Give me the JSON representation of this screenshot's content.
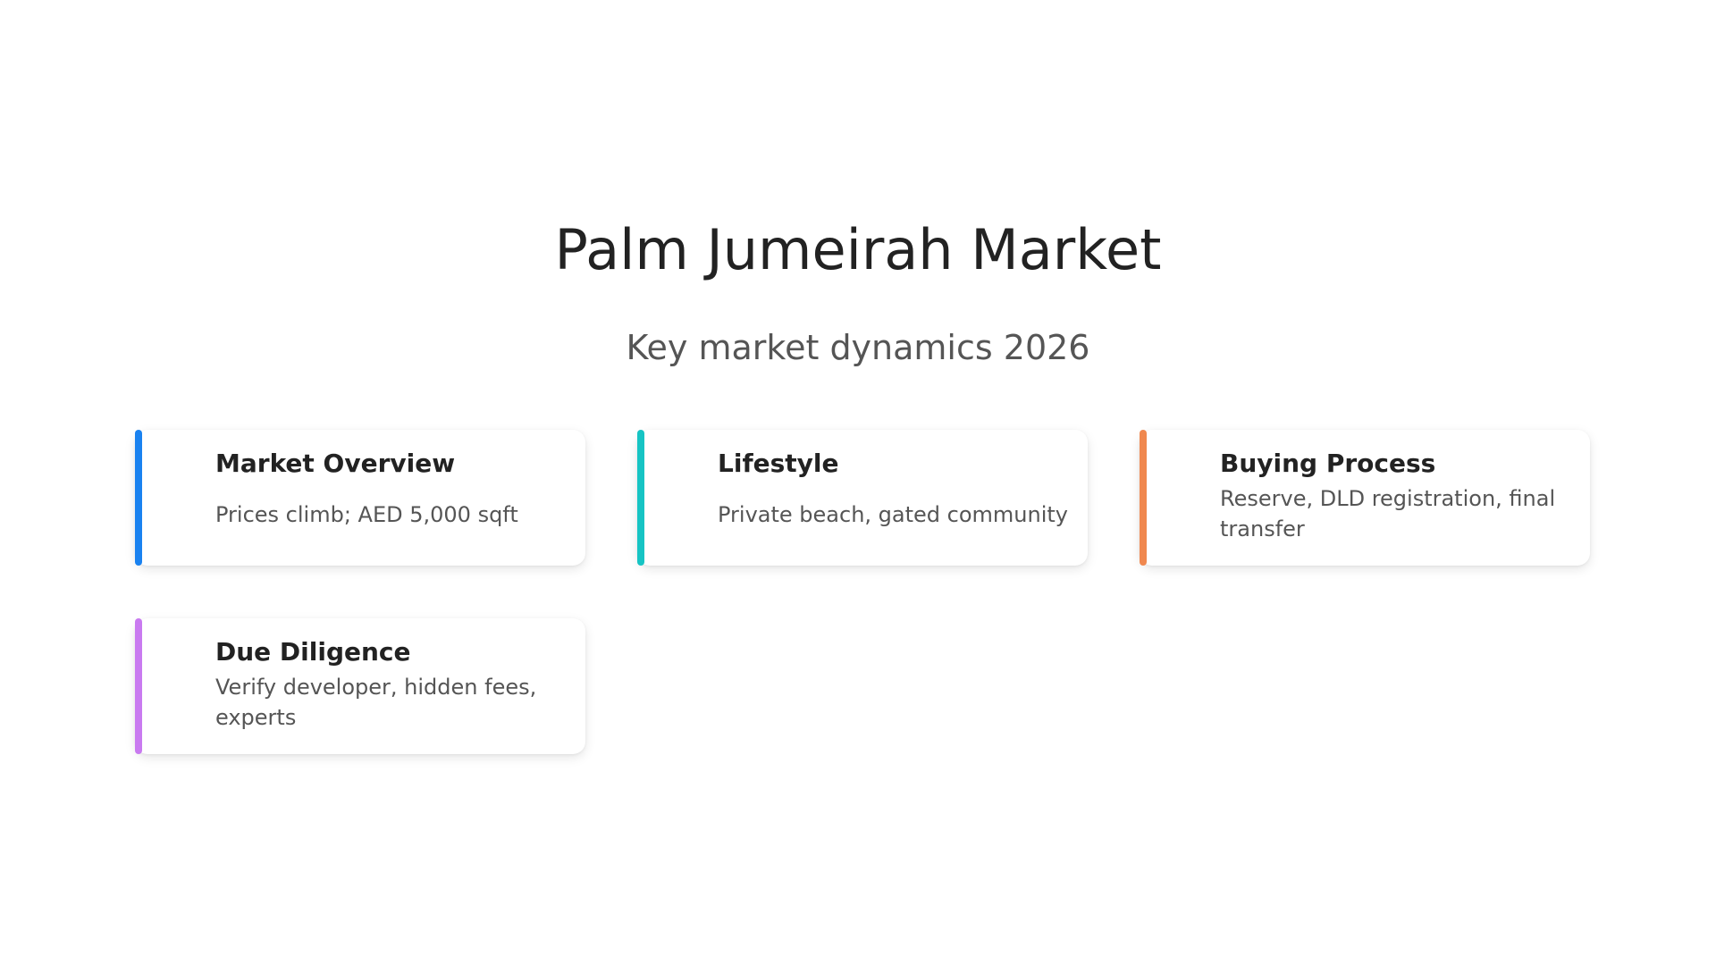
{
  "slide": {
    "title": "Palm Jumeirah Market",
    "subtitle": "Key market dynamics 2026"
  },
  "cards": [
    {
      "title": "Market Overview",
      "text": "Prices climb; AED 5,000 sqft",
      "accent": "#1a82f0"
    },
    {
      "title": "Lifestyle",
      "text": "Private beach, gated community",
      "accent": "#16c4c4"
    },
    {
      "title": "Buying Process",
      "text": "Reserve, DLD registration, final transfer",
      "accent": "#f0884f"
    },
    {
      "title": "Due Diligence",
      "text": "Verify developer, hidden fees, experts",
      "accent": "#c97af0"
    }
  ]
}
